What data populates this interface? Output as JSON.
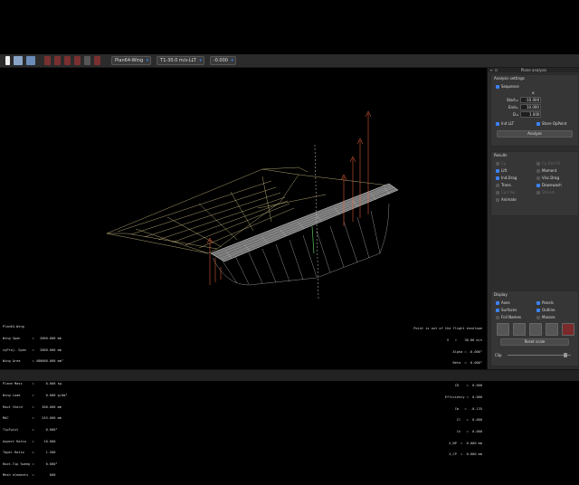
{
  "toolbar": {
    "plane_select": "Plan64-Wing",
    "polar_select": "T1-30.0 m/s-LLT",
    "opp_select": "-0.000",
    "icons": [
      "document-icon",
      "open-icon",
      "save-icon",
      "tool-icon",
      "tool-icon",
      "tool-icon",
      "tool-icon",
      "tool-icon",
      "tool-icon"
    ]
  },
  "panel": {
    "title": "Plane analysis",
    "analysis": {
      "header": "Analysis settings",
      "sequence_label": "Sequence",
      "alpha_symbol": "α",
      "start_label": "Start=",
      "start_value": "-10.000",
      "end_label": "End=",
      "end_value": "10.000",
      "delta_label": "D=",
      "delta_value": "1.000",
      "init_llt_label": "Init LLT",
      "store_opp_label": "Store OpPoint",
      "analyze_label": "Analyze"
    },
    "results": {
      "header": "Results",
      "items_left": [
        "Cp",
        "Lift",
        "Ind.Drag",
        "Trans.",
        "Curr.Vel.",
        "Animate"
      ],
      "items_right": [
        "Cp Dist.Fil",
        "Moment",
        "Visc.Drag",
        "Downwash",
        "Stream"
      ],
      "checked_left": [
        false,
        true,
        true,
        false,
        false,
        false
      ],
      "checked_right": [
        false,
        false,
        false,
        true,
        false
      ],
      "dim_left": [
        true,
        false,
        false,
        false,
        true,
        false
      ],
      "dim_right": [
        true,
        false,
        false,
        false,
        true
      ]
    },
    "display": {
      "header": "Display",
      "items_left": [
        "Axes",
        "Surfaces",
        "Foil Names"
      ],
      "items_right": [
        "Panels",
        "Outline",
        "Masses"
      ],
      "checked_left": [
        true,
        true,
        false
      ],
      "checked_right": [
        true,
        true,
        false
      ],
      "reset_scale_label": "Reset scale",
      "clip_label": "Clip"
    }
  },
  "info_left": {
    "lines": [
      "Plan64-Wing",
      "Wing Span      =   2000.000 mm",
      "xyProj. Span   =   2000.000 mm",
      "Wing Area      = 480000.000 mm²",
      "xyProj. Area   = 480000.000 mm²",
      "Plane Mass     =      0.000 kg",
      "Wing Load      =      0.000 g/dm²",
      "Root Chord     =    300.000 mm",
      "MAC            =    245.000 mm",
      "TipTwist       =      0.000°",
      "Aspect Ratio   =     10.000",
      "Taper Ratio    =      1.500",
      "Root-Tip Sweep =      0.000°",
      "Mesh elements  =        800"
    ]
  },
  "info_right": {
    "lines": [
      "Point is out of the flight envelope",
      "V   =    30.00 m/s",
      "Alpha = -0.000°",
      "Beta  =  0.000°",
      "CL    =  0.000",
      "CD    =  0.000",
      "Efficiency =  0.000",
      "Cm   =  -0.135",
      "Cl   =  0.000",
      "Cn   =  0.000",
      "X_NP  =  0.000 mm",
      "X_CP  =  0.000 mm"
    ]
  },
  "colors": {
    "accent": "#3b82f6",
    "wing_mesh": "#d0d0d0",
    "wireframe": "#d9c98a",
    "lift_arrows": "#ff6a3d",
    "axis_green": "#4caf50"
  }
}
